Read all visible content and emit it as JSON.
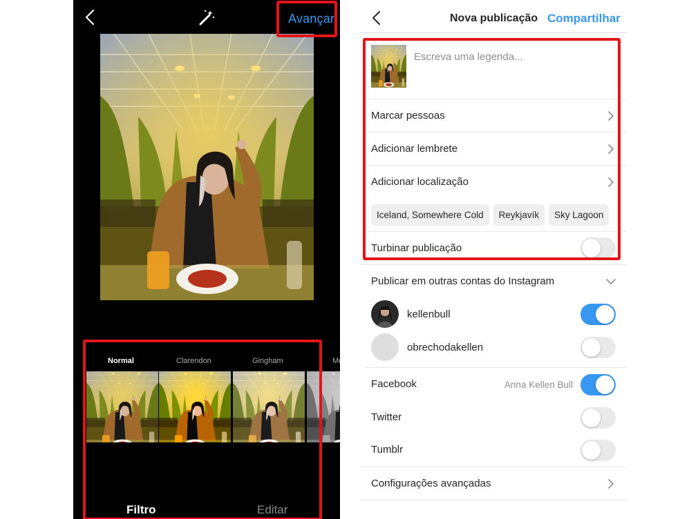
{
  "colors": {
    "accent": "#3897f0",
    "highlight": "#e3151a",
    "toggle_off": "#e9e9ea"
  },
  "editor": {
    "back_icon": "chevron-left-icon",
    "magic_icon": "magic-wand-icon",
    "next_label": "Avançar",
    "filters": [
      {
        "name": "Normal",
        "active": true
      },
      {
        "name": "Clarendon",
        "active": false
      },
      {
        "name": "Gingham",
        "active": false
      },
      {
        "name": "Mo",
        "active": false
      }
    ],
    "tabs": {
      "filter": "Filtro",
      "edit": "Editar"
    }
  },
  "post": {
    "title": "Nova publicação",
    "share_label": "Compartilhar",
    "caption_placeholder": "Escreva uma legenda...",
    "tag_people": "Marcar pessoas",
    "add_reminder": "Adicionar lembrete",
    "add_location": "Adicionar localização",
    "location_suggestions": [
      "Iceland, Somewhere Cold",
      "Reykjavík",
      "Sky Lagoon"
    ],
    "boost": {
      "label": "Turbinar publicação",
      "enabled": false
    },
    "other_accounts": {
      "label": "Publicar em outras contas do Instagram",
      "accounts": [
        {
          "username": "kellenbull",
          "enabled": true
        },
        {
          "username": "obrechodakellen",
          "enabled": false
        }
      ]
    },
    "facebook": {
      "label": "Facebook",
      "account": "Anna Kellen Bull",
      "enabled": true
    },
    "twitter": {
      "label": "Twitter",
      "enabled": false
    },
    "tumblr": {
      "label": "Tumblr",
      "enabled": false
    },
    "advanced": "Configurações avançadas"
  }
}
